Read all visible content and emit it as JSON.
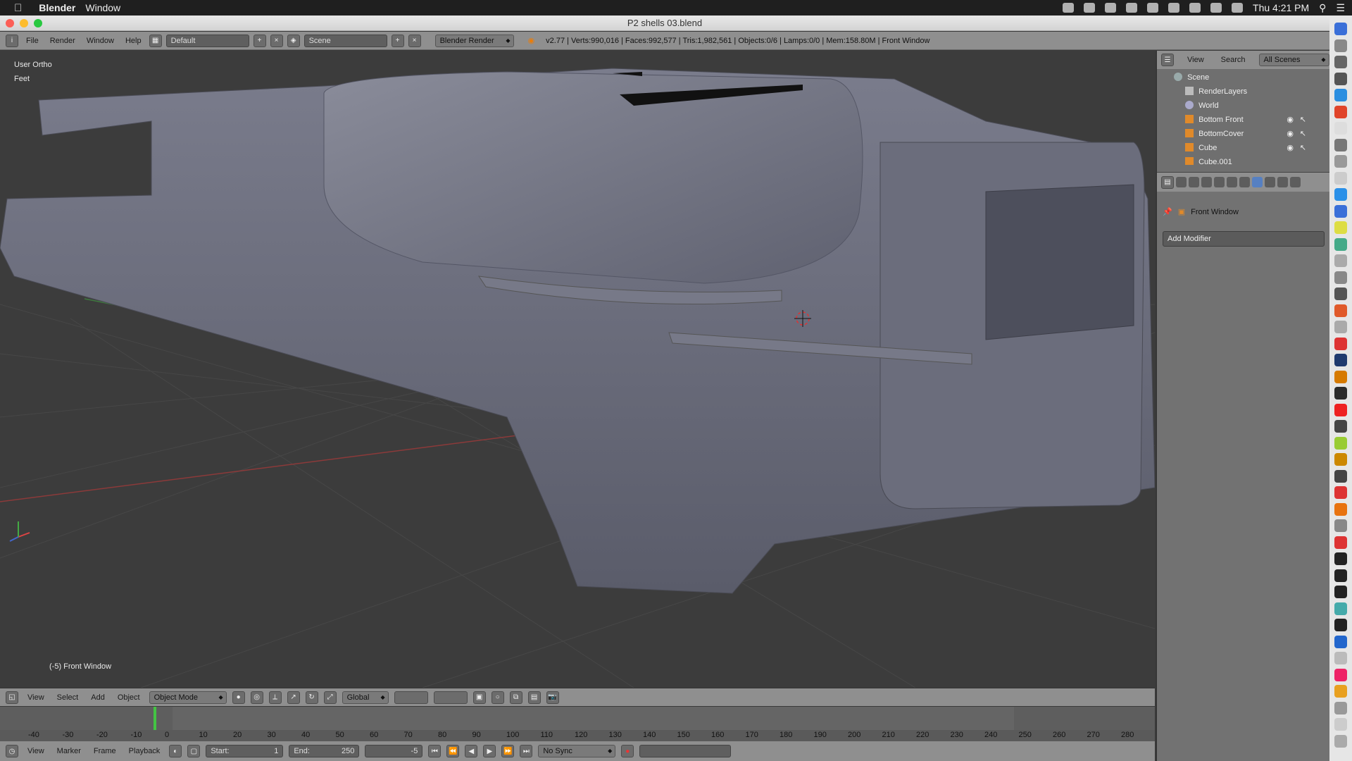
{
  "menubar": {
    "apple": "",
    "app": "Blender",
    "window": "Window",
    "clock": "Thu 4:21 PM"
  },
  "titlebar": {
    "title": "P2 shells 03.blend"
  },
  "info_header": {
    "menus": [
      "File",
      "Render",
      "Window",
      "Help"
    ],
    "layout": "Default",
    "scene": "Scene",
    "engine": "Blender Render",
    "stats": "v2.77 | Verts:990,016 | Faces:992,577 | Tris:1,982,561 | Objects:0/6 | Lamps:0/0 | Mem:158.80M | Front Window"
  },
  "viewport": {
    "view_label": "User Ortho",
    "units": "Feet",
    "footer": "(-5) Front Window"
  },
  "outliner": {
    "header": [
      "View",
      "Search"
    ],
    "filter": "All Scenes",
    "rows": [
      "Scene",
      "RenderLayers",
      "World",
      "Bottom Front",
      "BottomCover",
      "Cube",
      "Cube.001"
    ]
  },
  "properties": {
    "object_name": "Front Window",
    "add_modifier": "Add Modifier"
  },
  "view3d_header": {
    "menus": [
      "View",
      "Select",
      "Add",
      "Object"
    ],
    "mode": "Object Mode",
    "orientation": "Global"
  },
  "timeline": {
    "ticks": [
      "-40",
      "-30",
      "-20",
      "-10",
      "0",
      "10",
      "20",
      "30",
      "40",
      "50",
      "60",
      "70",
      "80",
      "90",
      "100",
      "110",
      "120",
      "130",
      "140",
      "150",
      "160",
      "170",
      "180",
      "190",
      "200",
      "210",
      "220",
      "230",
      "240",
      "250",
      "260",
      "270",
      "280"
    ],
    "menus": [
      "View",
      "Marker",
      "Frame",
      "Playback"
    ],
    "start_label": "Start:",
    "start": "1",
    "end_label": "End:",
    "end": "250",
    "current": "-5",
    "sync": "No Sync"
  }
}
